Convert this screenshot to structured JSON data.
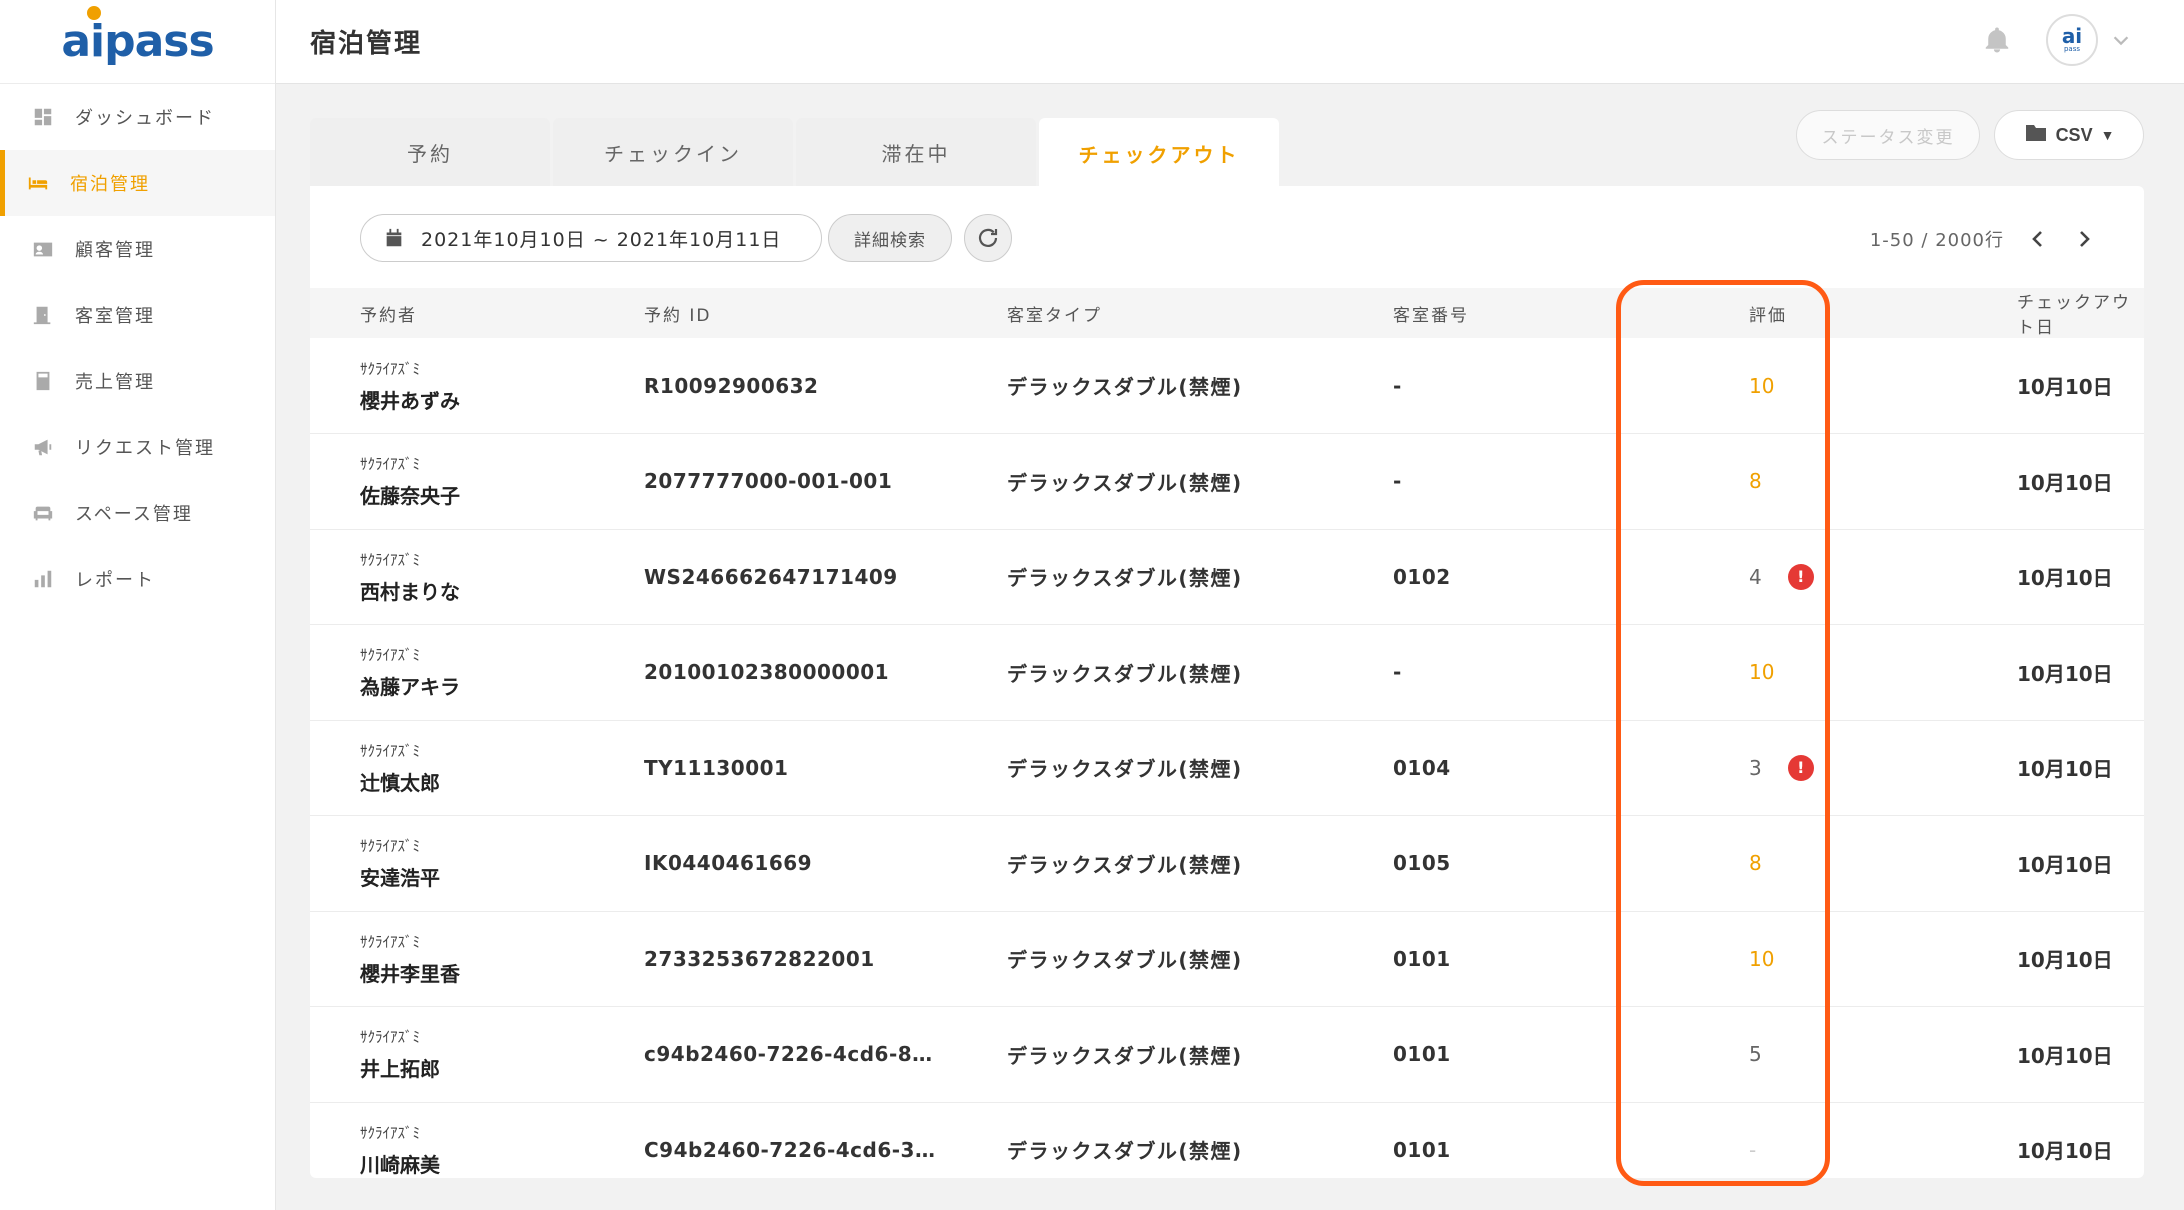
{
  "app": {
    "logo": "aipass"
  },
  "header": {
    "title": "宿泊管理",
    "avatar_text": "ai",
    "avatar_sub": "pass"
  },
  "sidebar": {
    "items": [
      {
        "label": "ダッシュボード",
        "icon": "dashboard-icon",
        "active": false
      },
      {
        "label": "宿泊管理",
        "icon": "bed-icon",
        "active": true
      },
      {
        "label": "顧客管理",
        "icon": "customer-card-icon",
        "active": false
      },
      {
        "label": "客室管理",
        "icon": "door-icon",
        "active": false
      },
      {
        "label": "売上管理",
        "icon": "calculator-icon",
        "active": false
      },
      {
        "label": "リクエスト管理",
        "icon": "megaphone-icon",
        "active": false
      },
      {
        "label": "スペース管理",
        "icon": "sofa-icon",
        "active": false
      },
      {
        "label": "レポート",
        "icon": "bar-chart-icon",
        "active": false
      }
    ]
  },
  "tabs": [
    {
      "label": "予約",
      "active": false
    },
    {
      "label": "チェックイン",
      "active": false
    },
    {
      "label": "滞在中",
      "active": false
    },
    {
      "label": "チェックアウト",
      "active": true
    }
  ],
  "actions": {
    "status_change": "ステータス変更",
    "csv": "CSV"
  },
  "toolbar": {
    "date_range": "2021年10月10日 ~ 2021年10月11日",
    "detail_search": "詳細検索",
    "pager_text": "1-50 / 2000行"
  },
  "table": {
    "columns": [
      "予約者",
      "予約 ID",
      "客室タイプ",
      "客室番号",
      "評価",
      "チェックアウト日"
    ],
    "rows": [
      {
        "kana": "ｻｸﾗｲｱｽﾞﾐ",
        "name": "櫻井あずみ",
        "id": "R10092900632",
        "room_type": "デラックスダブル(禁煙)",
        "room_no": "-",
        "rating": "10",
        "alert": false,
        "checkout": "10月10日"
      },
      {
        "kana": "ｻｸﾗｲｱｽﾞﾐ",
        "name": "佐藤奈央子",
        "id": "2077777000-001-001",
        "room_type": "デラックスダブル(禁煙)",
        "room_no": "-",
        "rating": "8",
        "alert": false,
        "checkout": "10月10日"
      },
      {
        "kana": "ｻｸﾗｲｱｽﾞﾐ",
        "name": "西村まりな",
        "id": "WS246662647171409",
        "room_type": "デラックスダブル(禁煙)",
        "room_no": "0102",
        "rating": "4",
        "alert": true,
        "checkout": "10月10日"
      },
      {
        "kana": "ｻｸﾗｲｱｽﾞﾐ",
        "name": "為藤アキラ",
        "id": "20100102380000001",
        "room_type": "デラックスダブル(禁煙)",
        "room_no": "-",
        "rating": "10",
        "alert": false,
        "checkout": "10月10日"
      },
      {
        "kana": "ｻｸﾗｲｱｽﾞﾐ",
        "name": "辻慎太郎",
        "id": "TY11130001",
        "room_type": "デラックスダブル(禁煙)",
        "room_no": "0104",
        "rating": "3",
        "alert": true,
        "checkout": "10月10日"
      },
      {
        "kana": "ｻｸﾗｲｱｽﾞﾐ",
        "name": "安達浩平",
        "id": "IK0440461669",
        "room_type": "デラックスダブル(禁煙)",
        "room_no": "0105",
        "rating": "8",
        "alert": false,
        "checkout": "10月10日"
      },
      {
        "kana": "ｻｸﾗｲｱｽﾞﾐ",
        "name": "櫻井李里香",
        "id": "2733253672822001",
        "room_type": "デラックスダブル(禁煙)",
        "room_no": "0101",
        "rating": "10",
        "alert": false,
        "checkout": "10月10日"
      },
      {
        "kana": "ｻｸﾗｲｱｽﾞﾐ",
        "name": "井上拓郎",
        "id": "c94b2460-7226-4cd6-8…",
        "room_type": "デラックスダブル(禁煙)",
        "room_no": "0101",
        "rating": "5",
        "alert": false,
        "checkout": "10月10日"
      },
      {
        "kana": "ｻｸﾗｲｱｽﾞﾐ",
        "name": "川崎麻美",
        "id": "C94b2460-7226-4cd6-3…",
        "room_type": "デラックスダブル(禁煙)",
        "room_no": "0101",
        "rating": "-",
        "alert": false,
        "checkout": "10月10日"
      }
    ]
  },
  "colors": {
    "accent": "#f0a000",
    "brand": "#1f5fa8",
    "highlight": "#ff5a14",
    "alert": "#e53935"
  }
}
